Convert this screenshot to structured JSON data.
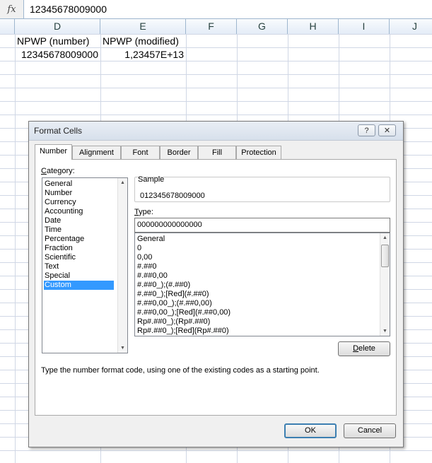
{
  "formula_bar": {
    "fx_label": "fx",
    "value": "12345678009000"
  },
  "columns": [
    "D",
    "E",
    "F",
    "G",
    "H",
    "I",
    "J"
  ],
  "cells": {
    "d1": "NPWP (number)",
    "e1": "NPWP (modified)",
    "d2": "12345678009000",
    "e2": "1,23457E+13"
  },
  "dialog": {
    "title": "Format Cells",
    "help_button": "?",
    "close_button": "✕",
    "tabs": [
      "Number",
      "Alignment",
      "Font",
      "Border",
      "Fill",
      "Protection"
    ],
    "active_tab": "Number",
    "category_label_first": "C",
    "category_label_rest": "ategory:",
    "categories": [
      "General",
      "Number",
      "Currency",
      "Accounting",
      "Date",
      "Time",
      "Percentage",
      "Fraction",
      "Scientific",
      "Text",
      "Special",
      "Custom"
    ],
    "selected_category": "Custom",
    "sample_label": "Sample",
    "sample_value": "012345678009000",
    "type_label_first": "T",
    "type_label_rest": "ype:",
    "type_value": "000000000000000",
    "format_codes": [
      "General",
      "0",
      "0,00",
      "#.##0",
      "#.##0,00",
      "#.##0_);(#.##0)",
      "#.##0_);[Red](#.##0)",
      "#.##0,00_);(#.##0,00)",
      "#.##0,00_);[Red](#.##0,00)",
      "Rp#.##0_);(Rp#.##0)",
      "Rp#.##0_);[Red](Rp#.##0)"
    ],
    "delete_first": "D",
    "delete_rest": "elete",
    "description": "Type the number format code, using one of the existing codes as a starting point.",
    "ok_label": "OK",
    "cancel_label": "Cancel"
  },
  "colors": {
    "selection": "#3399ff",
    "grid": "#d0d7e5",
    "header_border": "#9eb6ce",
    "default_button_border": "#3c7fb1"
  }
}
